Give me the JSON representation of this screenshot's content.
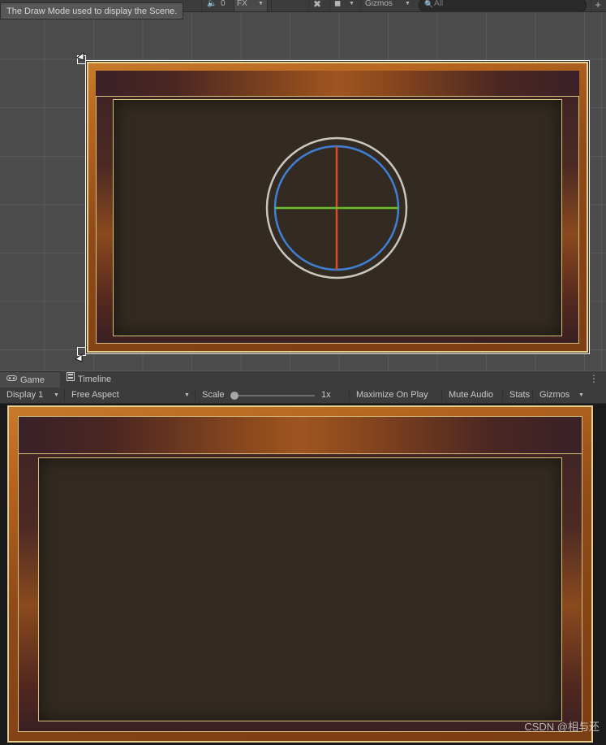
{
  "scene": {
    "tooltip": "The Draw Mode used to display the Scene.",
    "toolbar": {
      "audio_count": "0",
      "effects_label": "FX",
      "gizmos_label": "Gizmos",
      "search_placeholder": "All",
      "search_value": "",
      "search_icon": "search-icon",
      "plus_icon": "plus-icon",
      "light_icon": "light-icon",
      "audio_icon": "audio-mute-icon",
      "camera_icon": "camera-icon",
      "nolight_icon": "no-light-icon"
    },
    "gizmo": {
      "name": "rotation-gizmo",
      "outer_circle_color": "#c8c6c0",
      "inner_circle_color": "#3f7fd6",
      "x_axis_color": "#e04a27",
      "y_axis_color": "#6cbf2a"
    },
    "frame": {
      "name": "ornate-picture-frame",
      "gold_color": "#e6cf8e",
      "copper_color": "#b4641f",
      "maroon_color": "#4a2622",
      "interior_color": "#332b22"
    }
  },
  "game": {
    "tabs": [
      {
        "label": "Game",
        "icon": "gamepad-icon",
        "active": true
      },
      {
        "label": "Timeline",
        "icon": "film-strip-icon",
        "active": false
      }
    ],
    "kebab_icon": "more-options-icon",
    "toolbar": {
      "display_label": "Display 1",
      "aspect_label": "Free Aspect",
      "scale_label": "Scale",
      "scale_value": "1x",
      "maximize_label": "Maximize On Play",
      "mute_label": "Mute Audio",
      "stats_label": "Stats",
      "gizmos_label": "Gizmos"
    },
    "watermark": "CSDN @相与还"
  }
}
